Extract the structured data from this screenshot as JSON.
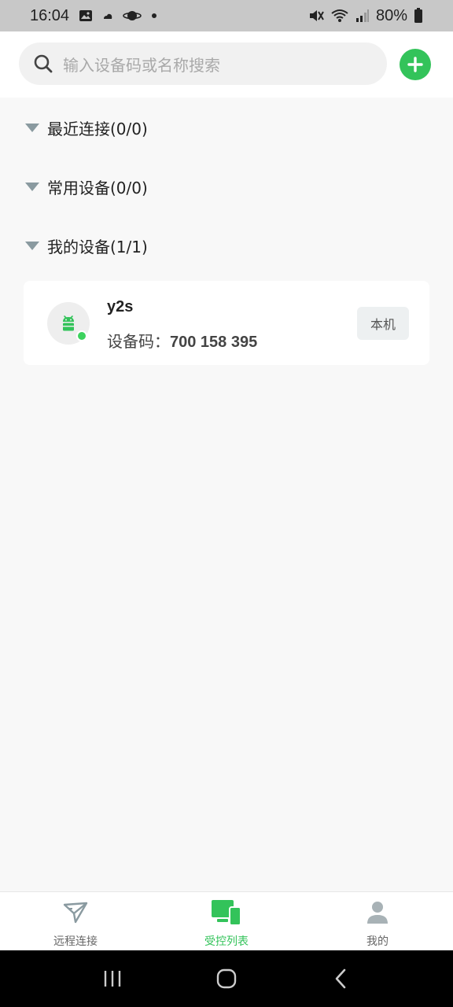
{
  "status_bar": {
    "time": "16:04",
    "battery": "80%",
    "icons": [
      "gallery-icon",
      "weather-icon",
      "saturn-icon",
      "dot-icon",
      "mute-icon",
      "wifi-icon",
      "signal-icon",
      "battery-icon"
    ]
  },
  "search": {
    "placeholder": "输入设备码或名称搜索"
  },
  "groups": [
    {
      "label": "最近连接(0/0)"
    },
    {
      "label": "常用设备(0/0)"
    },
    {
      "label": "我的设备(1/1)"
    }
  ],
  "device": {
    "name": "y2s",
    "code_label": "设备码：",
    "code_value": "700 158 395",
    "badge": "本机",
    "online": true,
    "icon": "android-icon"
  },
  "tabs": [
    {
      "label": "远程连接",
      "icon": "paper-plane-icon",
      "active": false
    },
    {
      "label": "受控列表",
      "icon": "devices-icon",
      "active": true
    },
    {
      "label": "我的",
      "icon": "person-icon",
      "active": false
    }
  ],
  "colors": {
    "accent": "#33c35a",
    "online": "#3cd25e",
    "background": "#f8f8f8"
  }
}
